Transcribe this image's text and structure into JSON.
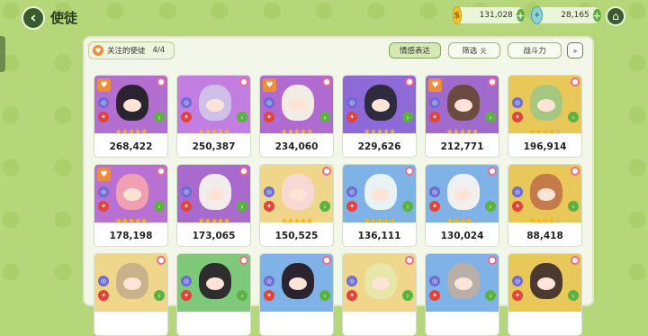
{
  "header": {
    "back_icon": "back-arrow-icon",
    "title": "使徒",
    "coins": "131,028",
    "gems": "28,165",
    "plus_glyph": "+",
    "home_icon": "home-icon"
  },
  "toolbar": {
    "favorite_label": "关注的使徒",
    "favorite_count": "4/4",
    "emotion_label": "情感表达",
    "filter_label": "筛选",
    "filter_state": "关",
    "sort_label": "战斗力",
    "sort_toggle_icon": "chevron-double-down-icon"
  },
  "cards": [
    {
      "power": "268,422",
      "stars": "★★★★★",
      "bg": "#b36fd0",
      "hair": "#2b2430",
      "fav": true
    },
    {
      "power": "250,387",
      "stars": "★★★★★",
      "bg": "#c27ee0",
      "hair": "#cfc0ea",
      "fav": false
    },
    {
      "power": "234,060",
      "stars": "★★★★★",
      "bg": "#b06ad0",
      "hair": "#f2ece4",
      "fav": true
    },
    {
      "power": "229,626",
      "stars": "★★★★★",
      "bg": "#8d6ad8",
      "hair": "#2e2b3e",
      "fav": false
    },
    {
      "power": "212,771",
      "stars": "★★★★★",
      "bg": "#a069cc",
      "hair": "#6b4a40",
      "fav": true
    },
    {
      "power": "196,914",
      "stars": "★★★★☆",
      "bg": "#e9c85a",
      "hair": "#a6c77f",
      "fav": false
    },
    {
      "power": "178,198",
      "stars": "★★★★★",
      "bg": "#b871d2",
      "hair": "#f0a0b0",
      "fav": true
    },
    {
      "power": "173,065",
      "stars": "★★★★★",
      "bg": "#a86acd",
      "hair": "#f3ecec",
      "fav": false
    },
    {
      "power": "150,525",
      "stars": "★★★★★",
      "bg": "#efd68a",
      "hair": "#f7d8d2",
      "fav": false
    },
    {
      "power": "136,111",
      "stars": "★★★★★",
      "bg": "#7fb3e8",
      "hair": "#e9f3f3",
      "fav": false
    },
    {
      "power": "130,024",
      "stars": "★★★★☆",
      "bg": "#7fb3e8",
      "hair": "#f0f0f0",
      "fav": false
    },
    {
      "power": "88,418",
      "stars": "★★★★☆",
      "bg": "#e9c85a",
      "hair": "#c57a4a",
      "fav": false
    },
    {
      "power": "",
      "stars": "",
      "bg": "#efd68a",
      "hair": "#c9b28a",
      "fav": false
    },
    {
      "power": "",
      "stars": "",
      "bg": "#7ec97a",
      "hair": "#2e2e2e",
      "fav": false
    },
    {
      "power": "",
      "stars": "",
      "bg": "#7fb3e8",
      "hair": "#2b2430",
      "fav": false
    },
    {
      "power": "",
      "stars": "",
      "bg": "#efd68a",
      "hair": "#e6e7a8",
      "fav": false
    },
    {
      "power": "",
      "stars": "",
      "bg": "#7fb3e8",
      "hair": "#b8b0a8",
      "fav": false
    },
    {
      "power": "",
      "stars": "",
      "bg": "#e9c85a",
      "hair": "#4a3a30",
      "fav": false
    }
  ],
  "icons": {
    "heart": "♥",
    "class": "◎",
    "role": "✦",
    "arrow": "›",
    "new_dot": "new-dot-icon"
  },
  "colors": {
    "background": "#b5d77a",
    "accent_green": "#5cae3b",
    "favorite_orange": "#f08d3a",
    "star_gold": "#f2b619"
  }
}
